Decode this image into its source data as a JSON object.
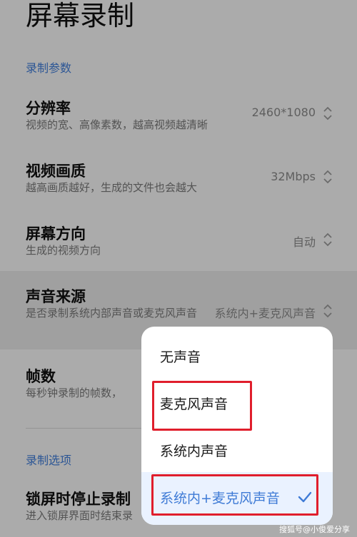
{
  "header": {
    "title": "屏幕录制"
  },
  "sections": {
    "params_label": "录制参数",
    "options_label": "录制选项"
  },
  "settings": [
    {
      "title": "分辨率",
      "subtitle": "视频的宽、高像素数，越高视频越清晰",
      "value": "2460*1080"
    },
    {
      "title": "视频画质",
      "subtitle": "越高画质越好，生成的文件也会越大",
      "value": "32Mbps"
    },
    {
      "title": "屏幕方向",
      "subtitle": "生成的视频方向",
      "value": "自动"
    },
    {
      "title": "声音来源",
      "subtitle": "是否录制系统内部声音或麦克风声音",
      "value": "系统内+麦克风声音"
    },
    {
      "title": "帧数",
      "subtitle": "每秒钟录制的帧数，",
      "value": ""
    }
  ],
  "lock_option": {
    "title": "锁屏时停止录制",
    "subtitle": "进入锁屏界面时结束录"
  },
  "sound_popup": {
    "options": [
      "无声音",
      "麦克风声音",
      "系统内声音",
      "系统内+麦克风声音"
    ],
    "selected_index": 3
  },
  "watermark": "搜狐号@小俊爱分享",
  "colors": {
    "accent": "#3f7bd6",
    "annotation": "#e01e2c"
  },
  "icons": {
    "value_picker": "updown-chevron-icon",
    "selected": "checkmark-icon"
  }
}
